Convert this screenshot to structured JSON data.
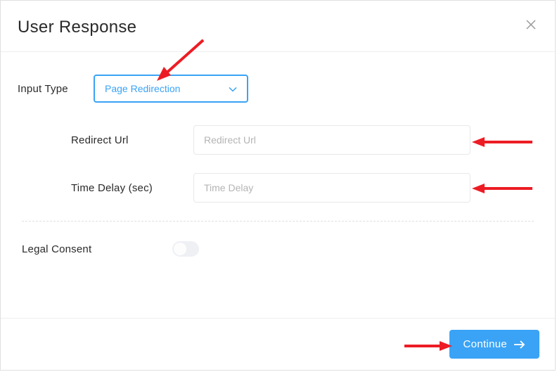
{
  "header": {
    "title": "User Response"
  },
  "form": {
    "input_type_label": "Input Type",
    "input_type_selected": "Page Redirection",
    "redirect_url_label": "Redirect Url",
    "redirect_url_placeholder": "Redirect Url",
    "redirect_url_value": "",
    "time_delay_label": "Time Delay (sec)",
    "time_delay_placeholder": "Time Delay",
    "time_delay_value": "",
    "legal_consent_label": "Legal Consent",
    "legal_consent_value": false
  },
  "footer": {
    "continue_label": "Continue"
  },
  "colors": {
    "accent": "#3aa3f5"
  }
}
